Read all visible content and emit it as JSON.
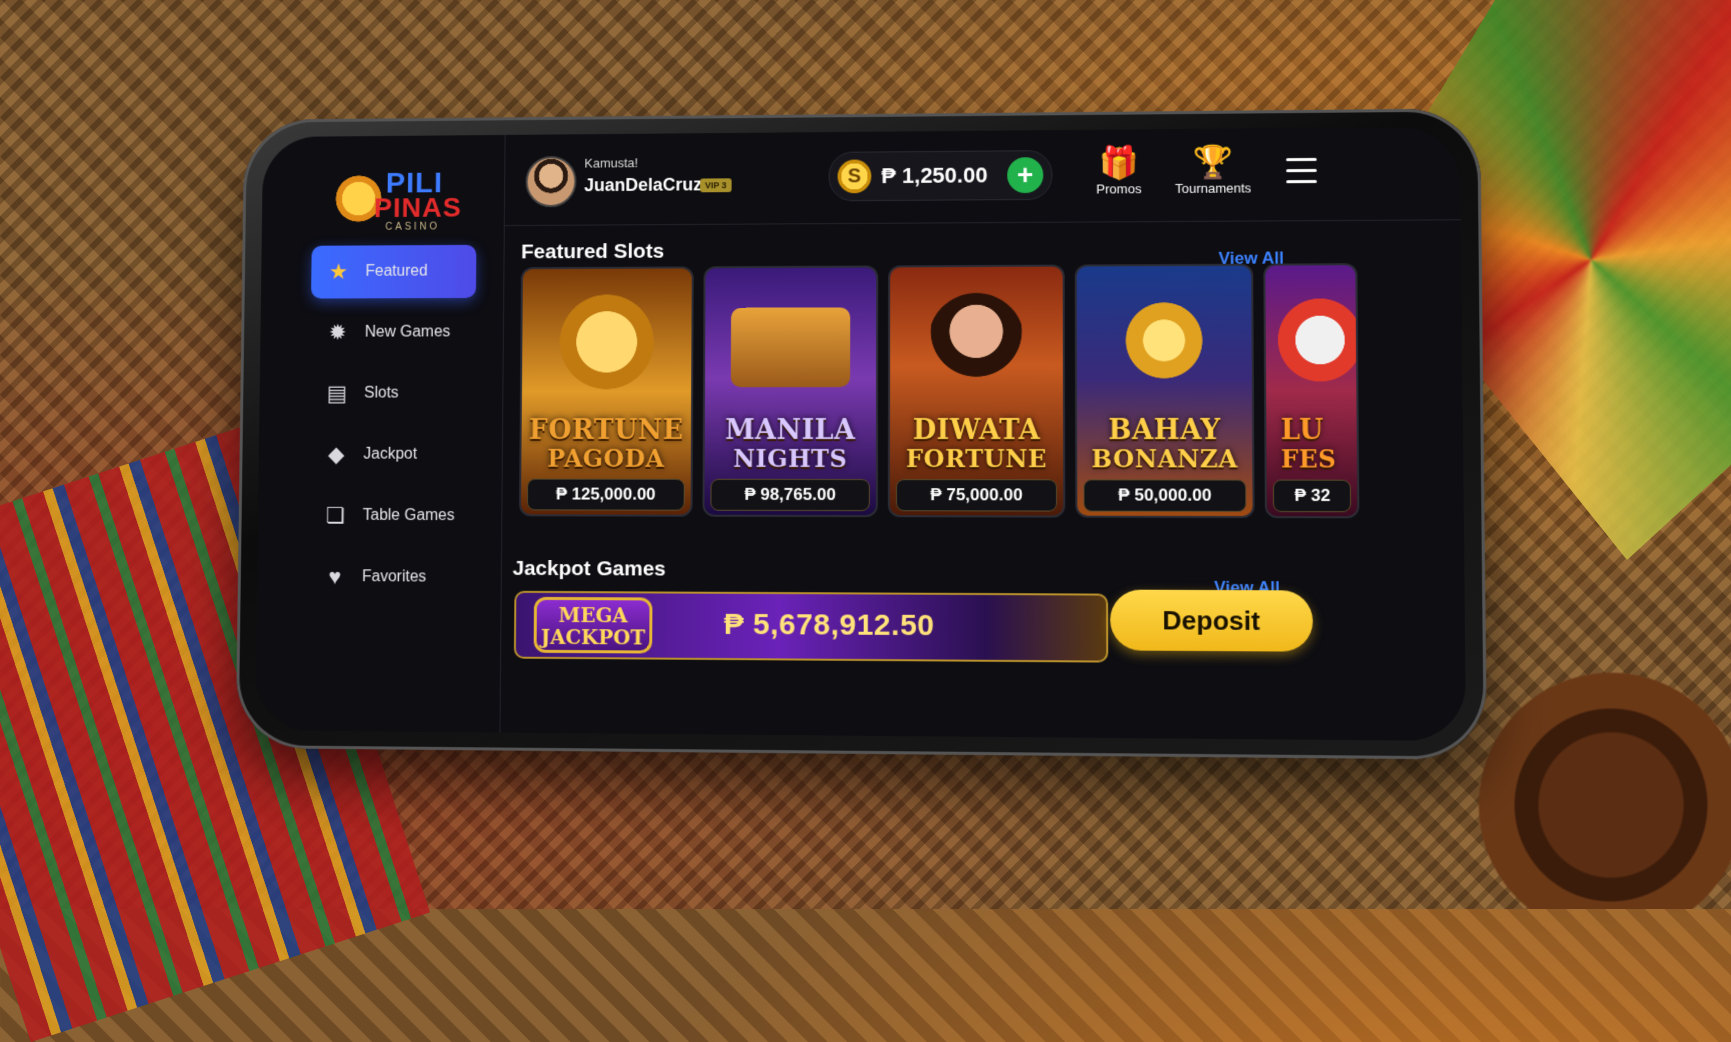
{
  "brand": {
    "line1": "PILI",
    "line2": "PINAS",
    "line3": "CASINO"
  },
  "user": {
    "greeting": "Kamusta!",
    "name": "JuanDelaCruz",
    "badge": "VIP 3"
  },
  "wallet": {
    "coin_symbol": "S",
    "balance": "₱ 1,250.00",
    "add_label": "+"
  },
  "header": {
    "promos_label": "Promos",
    "tournaments_label": "Tournaments",
    "promos_icon": "gift-icon",
    "tournaments_icon": "trophy-icon",
    "menu_icon": "hamburger-menu-icon"
  },
  "sidebar": {
    "items": [
      {
        "label": "Featured",
        "icon": "star-icon",
        "glyph": "★",
        "active": true
      },
      {
        "label": "New Games",
        "icon": "new-badge-icon",
        "glyph": "✹",
        "active": false
      },
      {
        "label": "Slots",
        "icon": "slot-machine-icon",
        "glyph": "▤",
        "active": false
      },
      {
        "label": "Jackpot",
        "icon": "diamond-icon",
        "glyph": "◆",
        "active": false
      },
      {
        "label": "Table Games",
        "icon": "cards-icon",
        "glyph": "❏",
        "active": false
      },
      {
        "label": "Favorites",
        "icon": "heart-icon",
        "glyph": "♥",
        "active": false
      }
    ]
  },
  "featured": {
    "title": "Featured Slots",
    "view_all": "View All",
    "games": [
      {
        "line1": "FORTUNE",
        "line2": "PAGODA",
        "prize": "₱ 125,000.00",
        "color": "#f0a030"
      },
      {
        "line1": "MANILA",
        "line2": "NIGHTS",
        "prize": "₱ 98,765.00",
        "color": "#d8c8ff"
      },
      {
        "line1": "DIWATA",
        "line2": "FORTUNE",
        "prize": "₱ 75,000.00",
        "color": "#ffcf4a"
      },
      {
        "line1": "BAHAY",
        "line2": "BONANZA",
        "prize": "₱ 50,000.00",
        "color": "#ffcf4a"
      },
      {
        "line1": "LU",
        "line2": "FES",
        "prize": "₱ 32",
        "color": "#ff9a2a"
      }
    ]
  },
  "jackpot": {
    "title": "Jackpot Games",
    "view_all": "View All",
    "badge_line1": "MEGA",
    "badge_line2": "JACKPOT",
    "amount": "₱ 5,678,912.50",
    "deposit_label": "Deposit"
  }
}
